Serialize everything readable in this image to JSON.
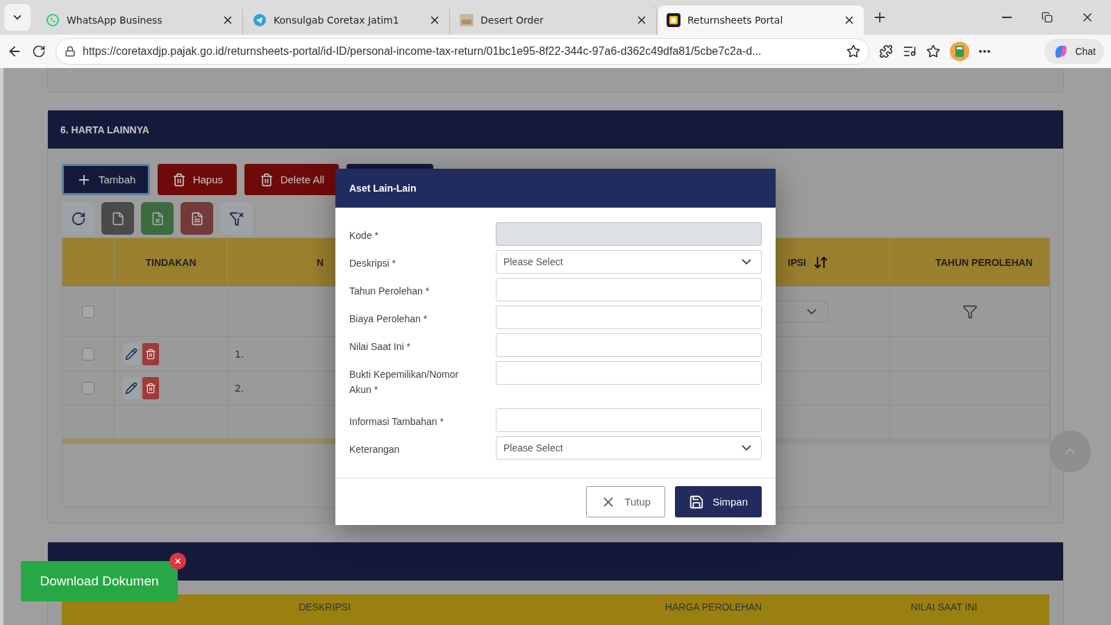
{
  "browser": {
    "tabs": [
      {
        "title": "WhatsApp Business",
        "selected": false
      },
      {
        "title": "Konsulgab Coretax Jatim1",
        "selected": false
      },
      {
        "title": "Desert Order",
        "selected": false
      },
      {
        "title": "Returnsheets Portal",
        "selected": true
      }
    ],
    "url": "https://coretaxdjp.pajak.go.id/returnsheets-portal/id-ID/personal-income-tax-return/01bc1e95-8f22-344c-97a6-d362c49dfa81/5cbe7c2a-d...",
    "chat": "Chat"
  },
  "section_6": {
    "title": "6. HARTA LAINNYA",
    "buttons": [
      {
        "label": "Tambah",
        "kind": "primary"
      },
      {
        "label": "Hapus",
        "kind": "danger"
      },
      {
        "label": "Delete All",
        "kind": "danger"
      },
      {
        "kind": "dark"
      }
    ],
    "table": {
      "columns": [
        {
          "label": "TINDAKAN"
        },
        {
          "label": "N"
        },
        {
          "label": "IPSI"
        },
        {
          "label": "TAHUN PEROLEHAN"
        }
      ],
      "filter_row": {
        "checked": false
      },
      "rows": [
        {
          "checked": false,
          "number": "1."
        },
        {
          "checked": false,
          "number": "2."
        }
      ]
    }
  },
  "section_7": {
    "columns": [
      "DESKRIPSI",
      "HARGA PEROLEHAN",
      "NILAI SAAT INI"
    ]
  },
  "modal": {
    "title": "Aset Lain-Lain",
    "fields": [
      {
        "label": "Kode *",
        "kind": "text",
        "disabled": true
      },
      {
        "label": "Deskripsi *",
        "kind": "select",
        "placeholder": "Please Select"
      },
      {
        "label": "Tahun Perolehan *",
        "kind": "text",
        "disabled": false
      },
      {
        "label": "Biaya Perolehan *",
        "kind": "text",
        "disabled": false
      },
      {
        "label": "Nilai Saat Ini *",
        "kind": "text",
        "disabled": false
      },
      {
        "label": "Bukti Kepemilikan/Nomor Akun *",
        "kind": "text",
        "disabled": false
      },
      {
        "label": "Informasi Tambahan *",
        "kind": "text",
        "disabled": false
      },
      {
        "label": "Keterangan",
        "kind": "select",
        "placeholder": "Please Select"
      }
    ],
    "buttons": [
      {
        "label": "Tutup",
        "kind": "secondary"
      },
      {
        "label": "Simpan",
        "kind": "primary"
      }
    ]
  },
  "download": {
    "label": "Download Dokumen"
  }
}
